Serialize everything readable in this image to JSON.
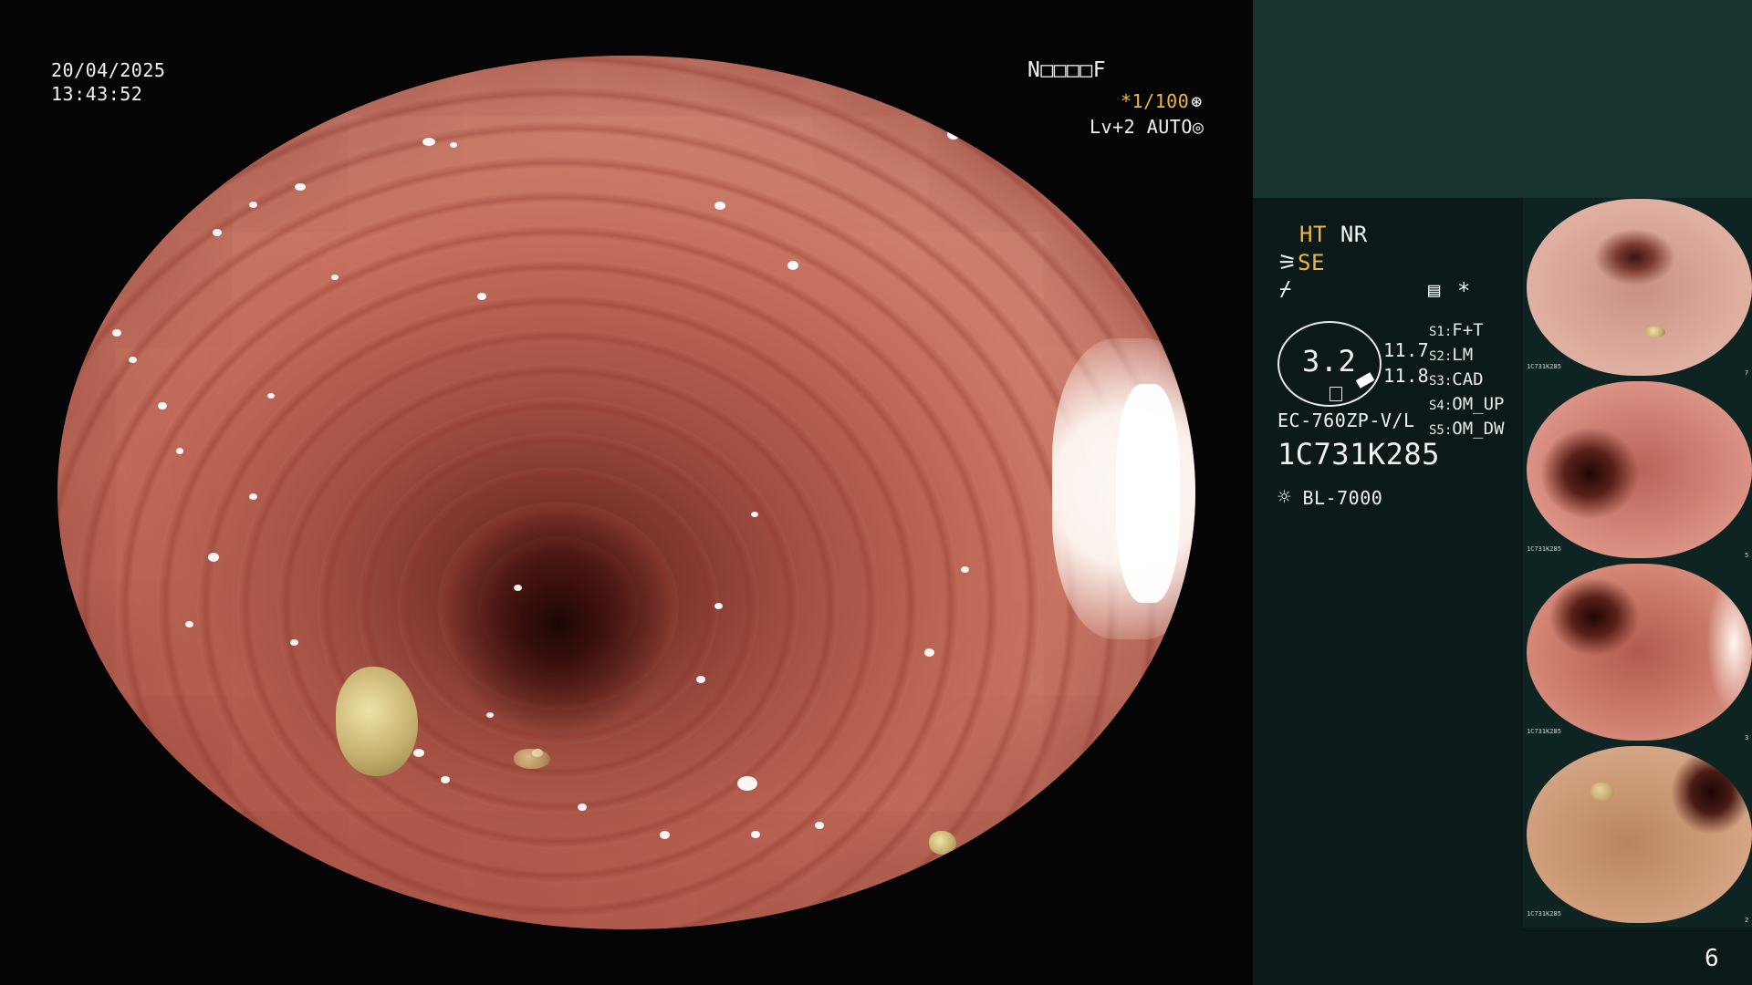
{
  "header": {
    "date": "20/04/2025",
    "time": "13:43:52",
    "patient_code": "N□□□□F",
    "shutter": "*1/100",
    "level": "Lv+2",
    "mode": "AUTO"
  },
  "settings": {
    "ht": "HT",
    "nr": "NR",
    "se": "SE",
    "size_value": "3.2",
    "val_a": "11.7",
    "val_b": "11.8",
    "star": "*",
    "s_modes": [
      {
        "key": "S1",
        "label": "F+T"
      },
      {
        "key": "S2",
        "label": "LM"
      },
      {
        "key": "S3",
        "label": "CAD"
      },
      {
        "key": "S4",
        "label": "OM_UP"
      },
      {
        "key": "S5",
        "label": "OM_DW"
      }
    ],
    "scope_model": "EC-760ZP-V/L",
    "scope_serial": "1C731K285",
    "light_source": "BL-7000"
  },
  "page_number": "6",
  "thumbnails": [
    {
      "label": "1C731K285",
      "index": "7"
    },
    {
      "label": "1C731K285",
      "index": "5"
    },
    {
      "label": "1C731K285",
      "index": "3"
    },
    {
      "label": "1C731K285",
      "index": "2"
    }
  ]
}
